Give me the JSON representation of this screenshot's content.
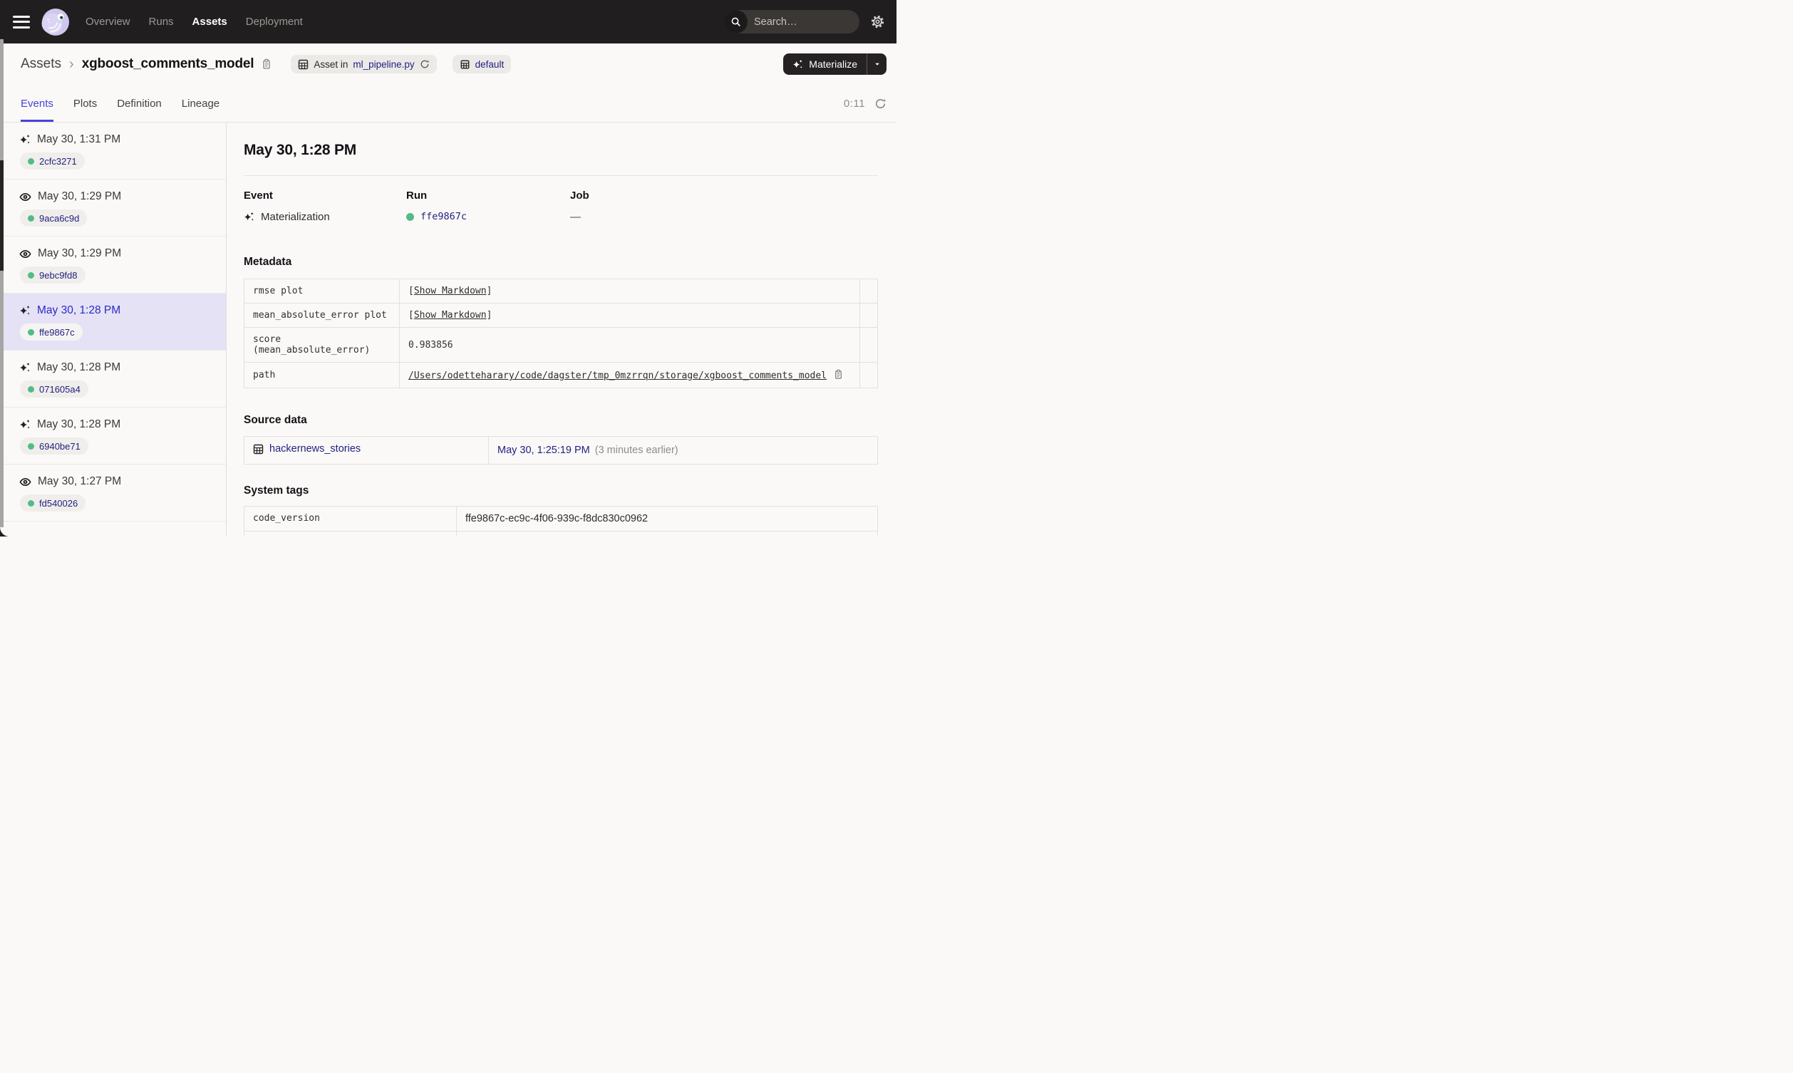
{
  "nav": {
    "links": [
      {
        "label": "Overview",
        "active": false
      },
      {
        "label": "Runs",
        "active": false
      },
      {
        "label": "Assets",
        "active": true
      },
      {
        "label": "Deployment",
        "active": false
      }
    ],
    "search": {
      "placeholder": "Search…",
      "shortcut": "/"
    }
  },
  "breadcrumb": {
    "root": "Assets",
    "separator": "›",
    "title": "xgboost_comments_model"
  },
  "badges": {
    "asset_in_prefix": "Asset in",
    "code_file": "ml_pipeline.py",
    "repo": "default"
  },
  "materialize": {
    "label": "Materialize"
  },
  "tabs": [
    {
      "label": "Events",
      "active": true
    },
    {
      "label": "Plots",
      "active": false
    },
    {
      "label": "Definition",
      "active": false
    },
    {
      "label": "Lineage",
      "active": false
    }
  ],
  "refresh": {
    "timer": "0:11"
  },
  "events": [
    {
      "type": "materialization",
      "time": "May 30, 1:31 PM",
      "run_id": "2cfc3271",
      "selected": false
    },
    {
      "type": "observation",
      "time": "May 30, 1:29 PM",
      "run_id": "9aca6c9d",
      "selected": false
    },
    {
      "type": "observation",
      "time": "May 30, 1:29 PM",
      "run_id": "9ebc9fd8",
      "selected": false
    },
    {
      "type": "materialization",
      "time": "May 30, 1:28 PM",
      "run_id": "ffe9867c",
      "selected": true
    },
    {
      "type": "materialization",
      "time": "May 30, 1:28 PM",
      "run_id": "071605a4",
      "selected": false
    },
    {
      "type": "materialization",
      "time": "May 30, 1:28 PM",
      "run_id": "6940be71",
      "selected": false
    },
    {
      "type": "observation",
      "time": "May 30, 1:27 PM",
      "run_id": "fd540026",
      "selected": false
    }
  ],
  "detail": {
    "title": "May 30, 1:28 PM",
    "event_label": "Event",
    "event_value": "Materialization",
    "run_label": "Run",
    "run_value": "ffe9867c",
    "job_label": "Job",
    "job_value": "—",
    "metadata_heading": "Metadata",
    "metadata_rows": [
      {
        "key": "rmse plot",
        "value_type": "markdown",
        "value": "Show Markdown"
      },
      {
        "key": "mean_absolute_error plot",
        "value_type": "markdown",
        "value": "Show Markdown"
      },
      {
        "key": "score (mean_absolute_error)",
        "value_type": "text",
        "value": "0.983856"
      },
      {
        "key": "path",
        "value_type": "path",
        "value": "/Users/odetteharary/code/dagster/tmp_0mzrrqn/storage/xgboost_comments_model"
      }
    ],
    "source_heading": "Source data",
    "source_rows": [
      {
        "asset": "hackernews_stories",
        "time": "May 30, 1:25:19 PM",
        "relative": "(3 minutes earlier)"
      }
    ],
    "tags_heading": "System tags",
    "tag_rows": [
      {
        "key": "code_version",
        "value": "ffe9867c-ec9c-4f06-939c-f8dc830c0962"
      }
    ]
  },
  "colors": {
    "nav_bg": "#211E1F",
    "accent_blue": "#4742D8",
    "selected_time_blue": "#2B28C7",
    "link_navy": "#232181",
    "success_green": "#53BB87",
    "selected_row_bg": "#E5E2F6",
    "page_bg": "#FAF9F7"
  }
}
